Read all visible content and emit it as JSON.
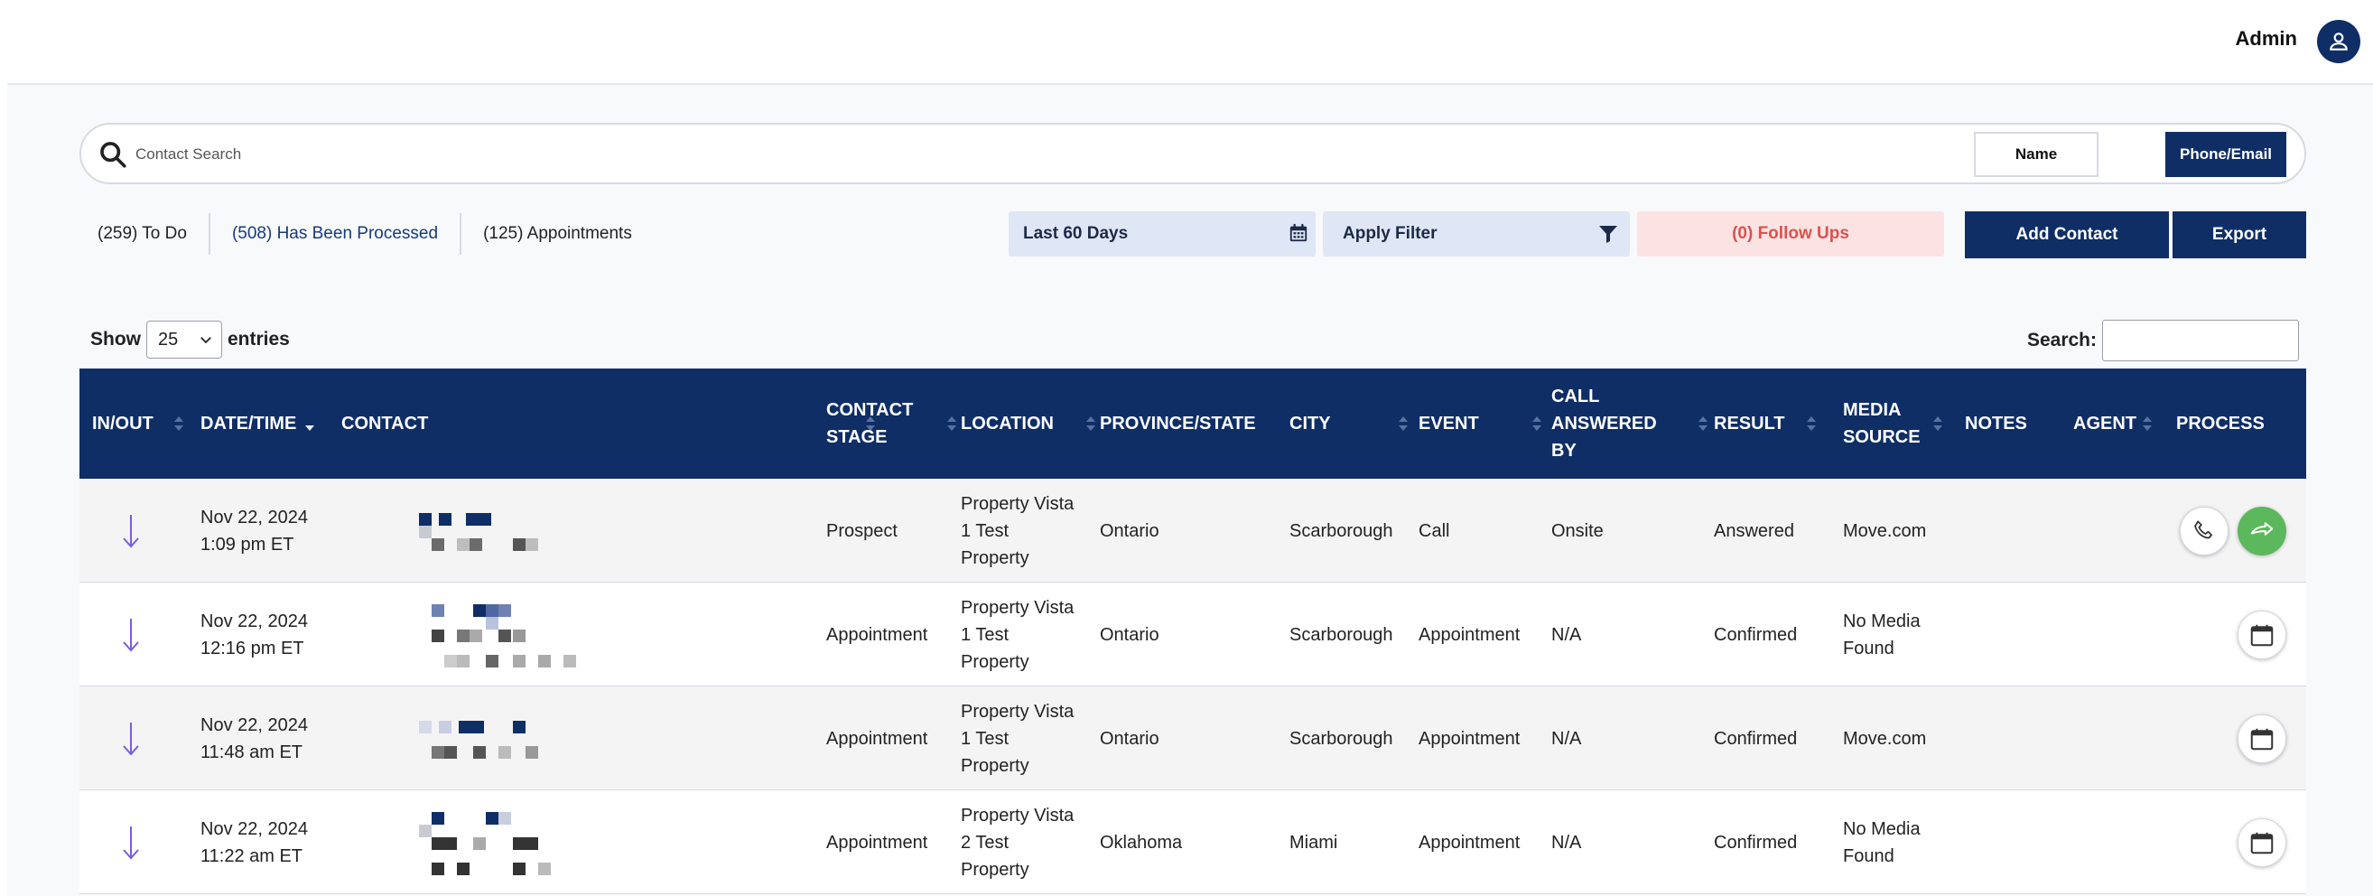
{
  "header": {
    "user_name": "Admin",
    "avatar_icon": "user-icon"
  },
  "search": {
    "placeholder": "Contact Search",
    "modes": [
      "Name",
      "Phone/Email"
    ],
    "active_mode": "Phone/Email"
  },
  "status_filters": [
    {
      "label": "(259) To Do",
      "active": false
    },
    {
      "label": "(508) Has Been Processed",
      "active": true
    },
    {
      "label": "(125) Appointments",
      "active": false
    }
  ],
  "date_range": {
    "label": "Last 60 Days",
    "icon": "calendar-icon"
  },
  "apply_filter": {
    "label": "Apply Filter",
    "icon": "filter-icon"
  },
  "follow_ups": {
    "label": "(0) Follow Ups"
  },
  "actions": {
    "add_contact": "Add Contact",
    "export": "Export"
  },
  "entries": {
    "show_label": "Show",
    "value": "25",
    "suffix": "entries"
  },
  "table_search": {
    "label": "Search:"
  },
  "colors": {
    "navy": "#0f2e66",
    "filter_bg": "#dfe6f5",
    "followup_bg": "#fbe3e3",
    "followup_text": "#d9534f",
    "arrow_purple": "#7a5de0",
    "green": "#5cb85c"
  },
  "table": {
    "columns": [
      {
        "label": "IN/OUT",
        "lines": [
          "IN/OUT"
        ]
      },
      {
        "label": "DATE/TIME",
        "lines": [
          "DATE/TIME"
        ]
      },
      {
        "label": "CONTACT",
        "lines": [
          "CONTACT"
        ]
      },
      {
        "label": "CONTACT STAGE",
        "lines": [
          "CONTACT",
          "STAGE"
        ]
      },
      {
        "label": "LOCATION",
        "lines": [
          "LOCATION"
        ]
      },
      {
        "label": "PROVINCE/STATE",
        "lines": [
          "PROVINCE/STATE"
        ]
      },
      {
        "label": "CITY",
        "lines": [
          "CITY"
        ]
      },
      {
        "label": "EVENT",
        "lines": [
          "EVENT"
        ]
      },
      {
        "label": "CALL ANSWERED BY",
        "lines": [
          "CALL",
          "ANSWERED",
          "BY"
        ]
      },
      {
        "label": "RESULT",
        "lines": [
          "RESULT"
        ]
      },
      {
        "label": "MEDIA SOURCE",
        "lines": [
          "MEDIA",
          "SOURCE"
        ]
      },
      {
        "label": "NOTES",
        "lines": [
          "NOTES"
        ]
      },
      {
        "label": "AGENT",
        "lines": [
          "AGENT"
        ]
      },
      {
        "label": "PROCESS",
        "lines": [
          "PROCESS"
        ]
      }
    ],
    "rows": [
      {
        "direction": "incoming",
        "date": "Nov 22, 2024",
        "time": "1:09 pm ET",
        "stage": "Prospect",
        "location": [
          "Property Vista",
          "1 Test",
          "Property"
        ],
        "province": "Ontario",
        "city": "Scarborough",
        "event": "Call",
        "answered_by": "Onsite",
        "result": "Answered",
        "media_source": [
          "Move.com"
        ],
        "notes": "",
        "agent": "",
        "process": [
          "phone-icon",
          "forward-icon"
        ]
      },
      {
        "direction": "incoming",
        "date": "Nov 22, 2024",
        "time": "12:16 pm ET",
        "stage": "Appointment",
        "location": [
          "Property Vista",
          "1 Test",
          "Property"
        ],
        "province": "Ontario",
        "city": "Scarborough",
        "event": "Appointment",
        "answered_by": "N/A",
        "result": "Confirmed",
        "media_source": [
          "No Media",
          "Found"
        ],
        "notes": "",
        "agent": "",
        "process": [
          "calendar-icon"
        ]
      },
      {
        "direction": "incoming",
        "date": "Nov 22, 2024",
        "time": "11:48 am ET",
        "stage": "Appointment",
        "location": [
          "Property Vista",
          "1 Test",
          "Property"
        ],
        "province": "Ontario",
        "city": "Scarborough",
        "event": "Appointment",
        "answered_by": "N/A",
        "result": "Confirmed",
        "media_source": [
          "Move.com"
        ],
        "notes": "",
        "agent": "",
        "process": [
          "calendar-icon"
        ]
      },
      {
        "direction": "incoming",
        "date": "Nov 22, 2024",
        "time": "11:22 am ET",
        "stage": "Appointment",
        "location": [
          "Property Vista",
          "2 Test",
          "Property"
        ],
        "province": "Oklahoma",
        "city": "Miami",
        "event": "Appointment",
        "answered_by": "N/A",
        "result": "Confirmed",
        "media_source": [
          "No Media",
          "Found"
        ],
        "notes": "",
        "agent": "",
        "process": [
          "calendar-icon"
        ]
      }
    ]
  }
}
